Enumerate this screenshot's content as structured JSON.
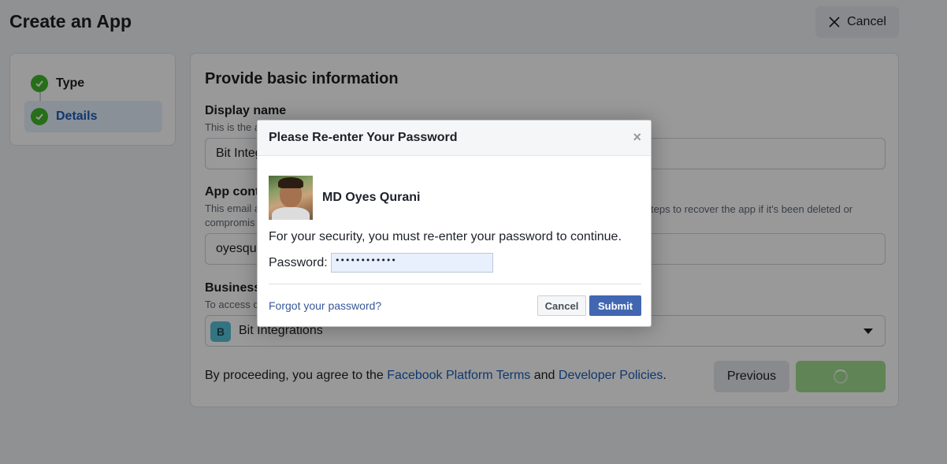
{
  "page": {
    "title": "Create an App",
    "cancel_label": "Cancel"
  },
  "steps": [
    {
      "label": "Type",
      "status": "complete"
    },
    {
      "label": "Details",
      "status": "current"
    }
  ],
  "form": {
    "title": "Provide basic information",
    "display_name": {
      "label": "Display name",
      "help_visible": "This is the a",
      "value_visible": "Bit Integ"
    },
    "app_contact": {
      "label_visible": "App conta",
      "help_line1_visible": "This email a",
      "help_line2_visible": "compromis",
      "help_right_visible": "teps to recover the app if it's been deleted or",
      "value_visible": "oyesqur"
    },
    "business": {
      "label_visible": "Business",
      "help_visible": "To access c",
      "selected_letter": "B",
      "selected_value": "Bit Integrations"
    },
    "agreement": {
      "prefix": "By proceeding, you agree to the",
      "link1": "Facebook Platform Terms",
      "middle": "and",
      "link2": "Developer Policies",
      "suffix": "."
    },
    "previous_label": "Previous"
  },
  "dialog": {
    "title": "Please Re-enter Your Password",
    "close_symbol": "×",
    "user_name": "MD Oyes Qurani",
    "security_message": "For your security, you must re-enter your password to continue.",
    "password_label": "Password:",
    "password_value": "••••••••••••",
    "forgot_link": "Forgot your password?",
    "cancel_label": "Cancel",
    "submit_label": "Submit"
  },
  "colors": {
    "brand_blue": "#4267b2",
    "link_blue": "#1b5cb8",
    "success_green": "#42b72a",
    "next_button_disabled": "#a1dc8f"
  }
}
